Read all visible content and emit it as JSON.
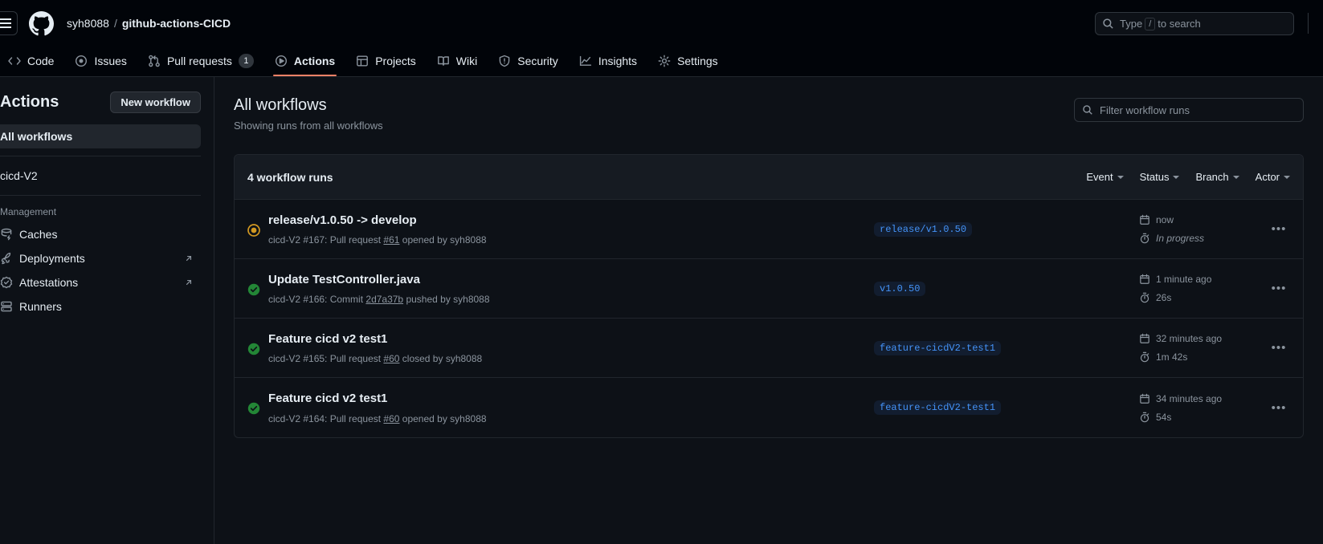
{
  "header": {
    "owner": "syh8088",
    "separator": "/",
    "repo": "github-actions-CICD",
    "search_placeholder_pre": "Type",
    "search_key": "/",
    "search_placeholder_post": "to search"
  },
  "repo_nav": [
    {
      "label": "Code",
      "icon": "code-icon",
      "selected": false
    },
    {
      "label": "Issues",
      "icon": "issue-opened-icon",
      "selected": false
    },
    {
      "label": "Pull requests",
      "icon": "git-pull-request-icon",
      "selected": false,
      "count": "1"
    },
    {
      "label": "Actions",
      "icon": "play-icon",
      "selected": true
    },
    {
      "label": "Projects",
      "icon": "table-icon",
      "selected": false
    },
    {
      "label": "Wiki",
      "icon": "book-icon",
      "selected": false
    },
    {
      "label": "Security",
      "icon": "shield-icon",
      "selected": false
    },
    {
      "label": "Insights",
      "icon": "graph-icon",
      "selected": false
    },
    {
      "label": "Settings",
      "icon": "gear-icon",
      "selected": false
    }
  ],
  "sidebar": {
    "title": "Actions",
    "new_workflow_button": "New workflow",
    "all_workflows": "All workflows",
    "workflows": [
      {
        "label": "cicd-V2"
      }
    ],
    "management_label": "Management",
    "management_items": [
      {
        "label": "Caches",
        "icon": "cache-icon",
        "external": false
      },
      {
        "label": "Deployments",
        "icon": "rocket-icon",
        "external": true
      },
      {
        "label": "Attestations",
        "icon": "verified-icon",
        "external": true
      },
      {
        "label": "Runners",
        "icon": "server-icon",
        "external": false
      }
    ]
  },
  "main": {
    "title": "All workflows",
    "subtitle": "Showing runs from all workflows",
    "filter_placeholder": "Filter workflow runs",
    "runs_count": "4 workflow runs",
    "filter_dropdowns": [
      "Event",
      "Status",
      "Branch",
      "Actor"
    ],
    "runs": [
      {
        "status": "in-progress",
        "title": "release/v1.0.50 -> develop",
        "meta_prefix": "cicd-V2 #167: Pull request ",
        "meta_link": "#61",
        "meta_suffix": " opened by syh8088",
        "branch": "release/v1.0.50",
        "time": "now",
        "duration": "In progress",
        "duration_italic": true
      },
      {
        "status": "success",
        "title": "Update TestController.java",
        "meta_prefix": "cicd-V2 #166: Commit ",
        "meta_link": "2d7a37b",
        "meta_suffix": " pushed by syh8088",
        "branch": "v1.0.50",
        "time": "1 minute ago",
        "duration": "26s",
        "duration_italic": false
      },
      {
        "status": "success",
        "title": "Feature cicd v2 test1",
        "meta_prefix": "cicd-V2 #165: Pull request ",
        "meta_link": "#60",
        "meta_suffix": " closed by syh8088",
        "branch": "feature-cicdV2-test1",
        "time": "32 minutes ago",
        "duration": "1m 42s",
        "duration_italic": false
      },
      {
        "status": "success",
        "title": "Feature cicd v2 test1",
        "meta_prefix": "cicd-V2 #164: Pull request ",
        "meta_link": "#60",
        "meta_suffix": " opened by syh8088",
        "branch": "feature-cicdV2-test1",
        "time": "34 minutes ago",
        "duration": "54s",
        "duration_italic": false
      }
    ],
    "kebab_label": "•••"
  },
  "colors": {
    "accent_tab": "#f78166",
    "success_green": "#3fb950",
    "in_progress_yellow": "#d29922",
    "branch_blue": "#4493f8"
  }
}
